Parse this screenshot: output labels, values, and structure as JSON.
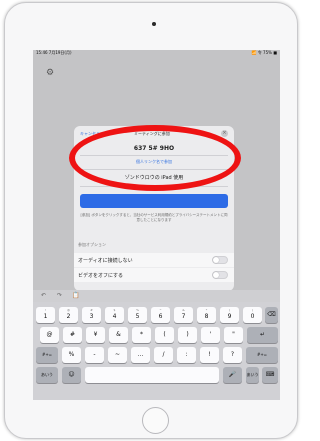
{
  "status_bar": {
    "left": "15:46 7月19日(月)",
    "right": "📶 令 75% ■"
  },
  "icons": {
    "gear": "gear-icon",
    "close": "close-icon",
    "undo": "undo-icon",
    "redo": "redo-icon",
    "clipboard": "clipboard-icon",
    "backspace": "backspace-icon",
    "return": "return-icon",
    "emoji": "emoji-icon",
    "keyboard_dismiss": "keyboard-dismiss-icon",
    "mic": "microphone-icon",
    "home": "home-button-icon"
  },
  "dialog": {
    "header_link": "キャンセル",
    "header_title": "ミーティングに参加",
    "meeting_id": "637 5# 9HO",
    "meeting_id_sub": "個人リンク名で参加",
    "name_field": "ゾンドウロウの iPad 使用",
    "fineprint": "[参加] ボタンをクリックすると、当社のサービス利用規約とプライバシーステートメントに同意したことになります",
    "options_header": "参加オプション",
    "option_audio": "オーディオに接続しない",
    "option_video": "ビデオをオフにする"
  },
  "keyboard": {
    "rows": [
      [
        {
          "main": "1",
          "sub": "!"
        },
        {
          "main": "2",
          "sub": "@"
        },
        {
          "main": "3",
          "sub": "#"
        },
        {
          "main": "4",
          "sub": "$"
        },
        {
          "main": "5",
          "sub": "%"
        },
        {
          "main": "6",
          "sub": "^"
        },
        {
          "main": "7",
          "sub": "&"
        },
        {
          "main": "8",
          "sub": "*"
        },
        {
          "main": "9",
          "sub": "("
        },
        {
          "main": "0",
          "sub": ")"
        }
      ],
      [
        {
          "main": "@"
        },
        {
          "main": "#"
        },
        {
          "main": "¥"
        },
        {
          "main": "&"
        },
        {
          "main": "*"
        },
        {
          "main": "("
        },
        {
          "main": ")"
        },
        {
          "main": "'"
        },
        {
          "main": "\""
        }
      ],
      [
        {
          "main": "#+="
        },
        {
          "main": "%"
        },
        {
          "main": "-"
        },
        {
          "main": "~"
        },
        {
          "main": "…"
        },
        {
          "main": "/"
        },
        {
          "main": ":"
        },
        {
          "main": "!"
        },
        {
          "main": "?"
        }
      ]
    ],
    "row1_backspace": "⌫",
    "row2_return": "↵",
    "row3_shift": "#+=",
    "bottom": {
      "left_switch": "あいう",
      "emoji": "☺",
      "right_switch": "あいう",
      "dismiss": "⌨"
    }
  },
  "shortcut_bar": {
    "undo": "↶",
    "redo": "↷",
    "clipboard": "📋"
  }
}
